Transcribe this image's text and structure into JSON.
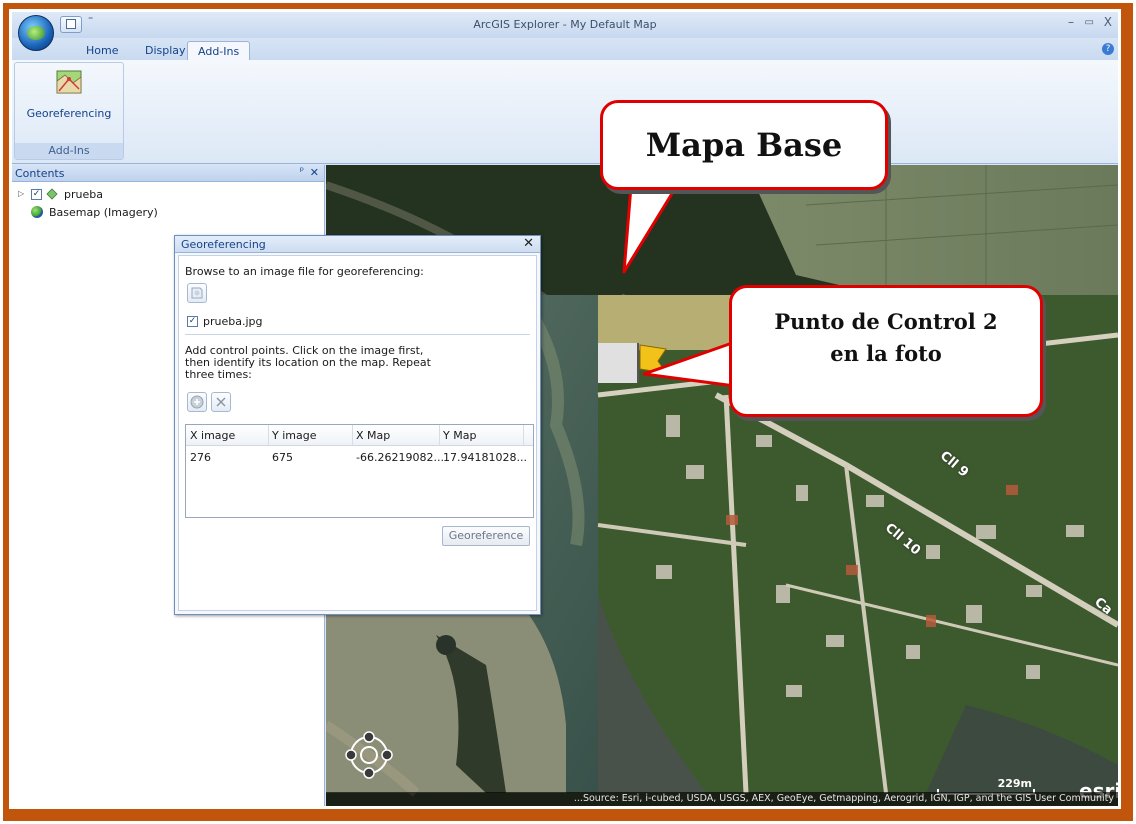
{
  "window": {
    "title": "ArcGIS Explorer - My Default Map",
    "minimize": "–",
    "restore": "▭",
    "close": "X"
  },
  "quick_access": {
    "more": "⁼"
  },
  "tabs": [
    {
      "label": "Home"
    },
    {
      "label": "Display"
    },
    {
      "label": "Add-Ins"
    }
  ],
  "help_glyph": "?",
  "ribbon": {
    "georeferencing_label": "Georeferencing",
    "group_label": "Add-Ins"
  },
  "contents": {
    "title": "Contents",
    "pin": "ᵖ",
    "close": "✕",
    "layers": [
      {
        "name": "prueba",
        "checked": "✓",
        "expander": "▷"
      },
      {
        "name": "Basemap (Imagery)"
      }
    ]
  },
  "dialog": {
    "title": "Georeferencing",
    "close": "✕",
    "browse_text": "Browse to an image file for georeferencing:",
    "file_name": "prueba.jpg",
    "file_checked": "✓",
    "instructions_1": "Add control points. Click on the image first,",
    "instructions_2": "then identify its location on the map. Repeat",
    "instructions_3": "three times:",
    "grid": {
      "columns": [
        "X image",
        "Y image",
        "X Map",
        "Y Map"
      ],
      "rows": [
        [
          "276",
          "675",
          "-66.26219082...",
          "17.94181028..."
        ]
      ]
    },
    "georeference_button": "Georeference"
  },
  "map": {
    "attribution": "...Source: Esri, i-cubed, USDA, USGS, AEX, GeoEye, Getmapping, Aerogrid, IGN, IGP, and the GIS User Community",
    "scale": "229m",
    "logo": "esri",
    "logo_mark": "®",
    "street_labels": [
      "Cll 9",
      "Cll 10",
      "Ca"
    ]
  },
  "callouts": {
    "mapa_base": "Mapa Base",
    "punto_line1": "Punto de Control 2",
    "punto_line2": "en la foto"
  },
  "colors": {
    "frame": "#c2550c",
    "callout_border": "#e00000",
    "ribbon_text": "#15428b"
  }
}
